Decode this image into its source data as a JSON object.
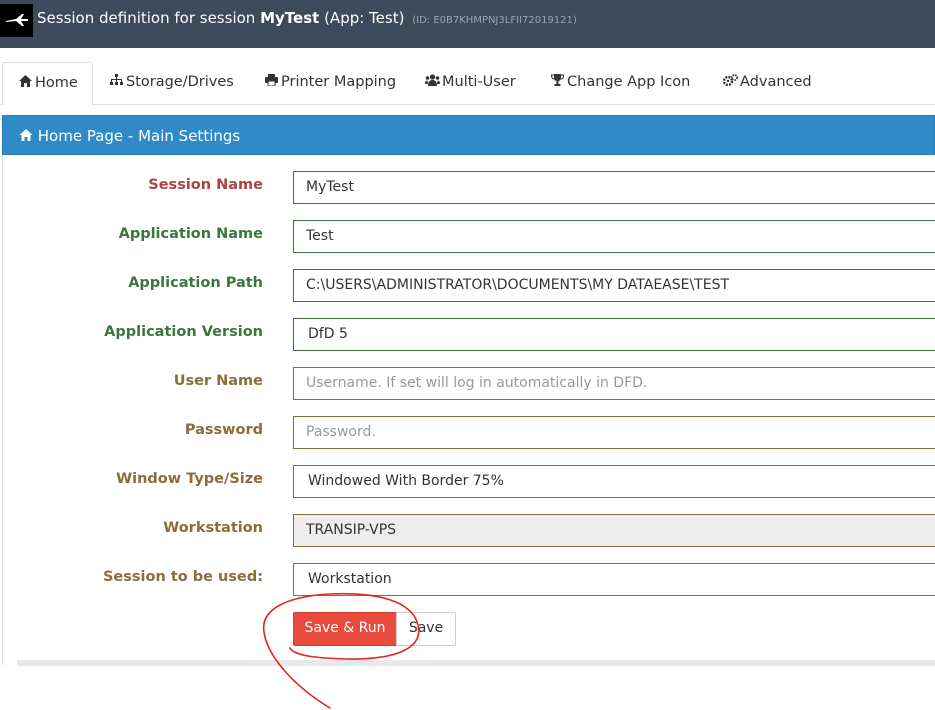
{
  "header": {
    "title_prefix": "Session definition for session",
    "session_name": "MyTest",
    "app_part": "(App: Test)",
    "id_text": "(ID: E0B7KHMPNJ3LFII72019121)"
  },
  "tabs": [
    {
      "label": "Home",
      "icon": "home-icon",
      "active": true
    },
    {
      "label": "Storage/Drives",
      "icon": "sitemap-icon"
    },
    {
      "label": "Printer Mapping",
      "icon": "printer-icon"
    },
    {
      "label": "Multi-User",
      "icon": "users-icon"
    },
    {
      "label": "Change App Icon",
      "icon": "trophy-icon"
    },
    {
      "label": "Advanced",
      "icon": "gears-icon"
    }
  ],
  "panel": {
    "title": "Home Page - Main Settings",
    "icon": "home-icon"
  },
  "form": {
    "session_name": {
      "label": "Session Name",
      "value": "MyTest"
    },
    "application_name": {
      "label": "Application Name",
      "value": "Test"
    },
    "application_path": {
      "label": "Application Path",
      "value": "C:\\USERS\\ADMINISTRATOR\\DOCUMENTS\\MY DATAEASE\\TEST"
    },
    "application_version": {
      "label": "Application Version",
      "value": "DfD 5"
    },
    "user_name": {
      "label": "User Name",
      "placeholder": "Username. If set will log in automatically in DFD."
    },
    "password": {
      "label": "Password",
      "placeholder": "Password."
    },
    "window_type": {
      "label": "Window Type/Size",
      "value": "Windowed With Border 75%"
    },
    "workstation": {
      "label": "Workstation",
      "value": "TRANSIP-VPS"
    },
    "session_to_use": {
      "label": "Session to be used:",
      "value": "Workstation"
    }
  },
  "buttons": {
    "save_run": "Save & Run",
    "save": "Save"
  },
  "colors": {
    "header_bg": "#3c4a5b",
    "panel_head": "#2e8bc8",
    "run_button": "#e74c3c",
    "annotation": "#e3261c",
    "label_red": "#a94442",
    "label_green": "#3c763d",
    "label_brown": "#8a6d3b"
  }
}
